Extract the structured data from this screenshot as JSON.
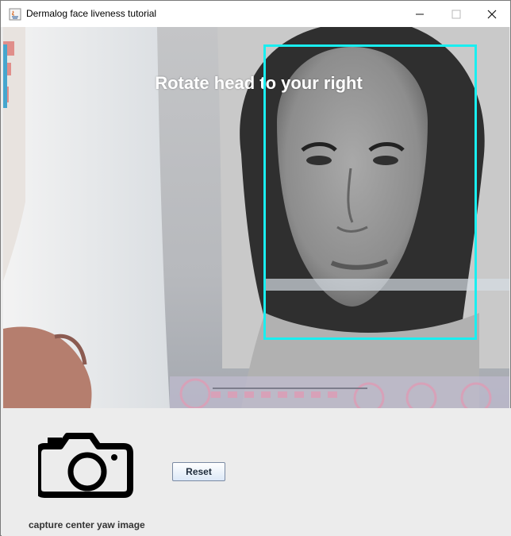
{
  "window": {
    "title": "Dermalog face liveness tutorial"
  },
  "video": {
    "instruction": "Rotate head to your right",
    "face_box_color": "#19eef0"
  },
  "controls": {
    "reset_label": "Reset",
    "status_text": "capture center yaw image"
  },
  "icons": {
    "app": "java-icon",
    "capture": "camera-icon"
  }
}
